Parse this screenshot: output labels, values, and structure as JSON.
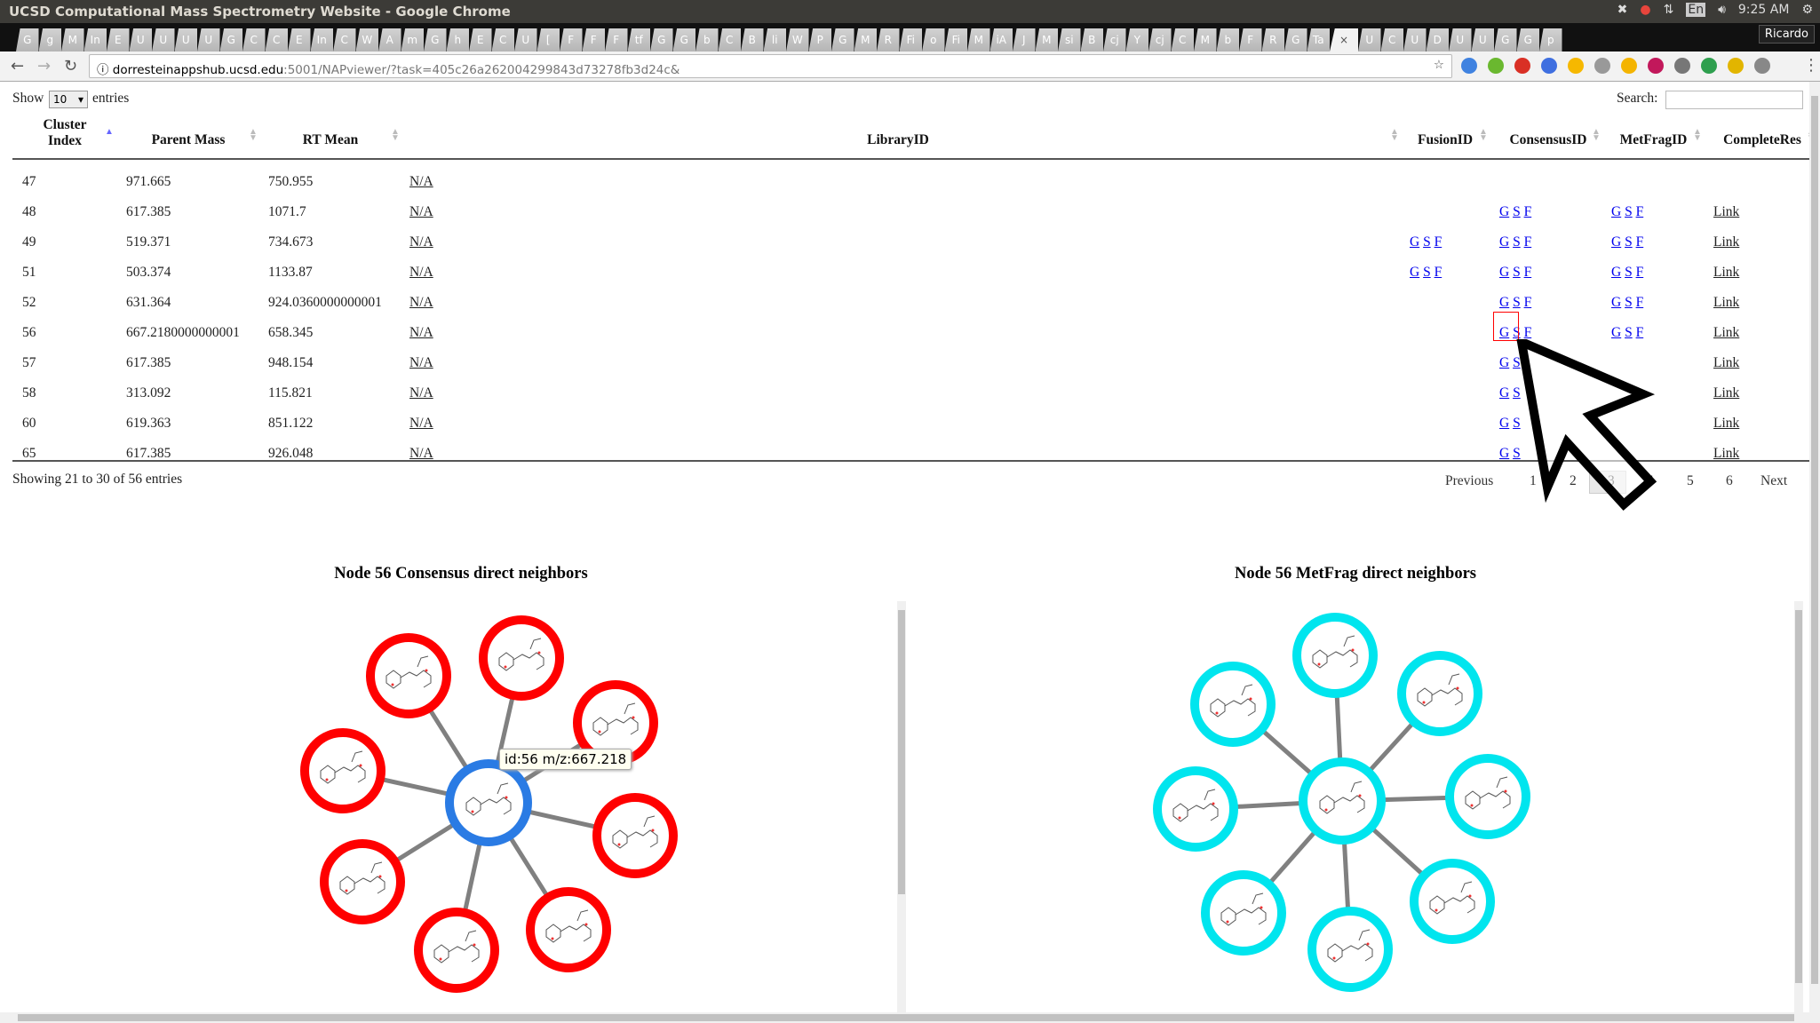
{
  "window": {
    "title": "UCSD Computational Mass Spectrometry Website - Google Chrome",
    "clock": "9:25 AM",
    "lang": "En",
    "user": "Ricardo"
  },
  "tabs": [
    "G",
    "g",
    "M",
    "In",
    "E",
    "U",
    "U",
    "U",
    "U",
    "G",
    "C",
    "C",
    "E",
    "In",
    "C",
    "W",
    "A",
    "m",
    "G",
    "h",
    "E",
    "C",
    "U",
    "[",
    "F",
    "F",
    "F",
    "tf",
    "G",
    "G",
    "b",
    "C",
    "B",
    "li",
    "W",
    "P",
    "G",
    "M",
    "R",
    "Fi",
    "o",
    "Fi",
    "M",
    "iA",
    "J",
    "M",
    "si",
    "B",
    "cj",
    "Y",
    "cj",
    "C",
    "M",
    "b",
    "F",
    "R",
    "G",
    "Ta",
    "×",
    "U",
    "C",
    "U",
    "D",
    "U",
    "U",
    "G",
    "G",
    "p"
  ],
  "active_tab_index": 58,
  "address": {
    "host": "dorresteinappshub.ucsd.edu",
    "rest": ":5001/NAPviewer/?task=405c26a262004299843d73278fb3d24c&"
  },
  "extension_icons": [
    "#3f82e0",
    "#6ab82f",
    "#d93025",
    "#3f6fe0",
    "#f6b800",
    "#999",
    "#f4b400",
    "#c2185b",
    "#777",
    "#2e9f4e",
    "#e2b500",
    "#888"
  ],
  "controls": {
    "show": "Show",
    "entries_value": "10",
    "entries": "entries",
    "search_label": "Search:",
    "search_value": ""
  },
  "columns": [
    "Cluster Index",
    "Parent Mass",
    "RT Mean",
    "LibraryID",
    "FusionID",
    "ConsensusID",
    "MetFragID",
    "CompleteRes"
  ],
  "rows": [
    {
      "cluster": "47",
      "mass": "971.665",
      "rt": "750.955",
      "lib": "N/A",
      "fusion": "",
      "consensus": "",
      "metfrag": "",
      "complete": ""
    },
    {
      "cluster": "48",
      "mass": "617.385",
      "rt": "1071.7",
      "lib": "N/A",
      "fusion": "",
      "consensus": "G S F",
      "metfrag": "G S F",
      "complete": "Link"
    },
    {
      "cluster": "49",
      "mass": "519.371",
      "rt": "734.673",
      "lib": "N/A",
      "fusion": "G S F",
      "consensus": "G S F",
      "metfrag": "G S F",
      "complete": "Link"
    },
    {
      "cluster": "51",
      "mass": "503.374",
      "rt": "1133.87",
      "lib": "N/A",
      "fusion": "G S F",
      "consensus": "G S F",
      "metfrag": "G S F",
      "complete": "Link"
    },
    {
      "cluster": "52",
      "mass": "631.364",
      "rt": "924.0360000000001",
      "lib": "N/A",
      "fusion": "",
      "consensus": "G S F",
      "metfrag": "G S F",
      "complete": "Link"
    },
    {
      "cluster": "56",
      "mass": "667.2180000000001",
      "rt": "658.345",
      "lib": "N/A",
      "fusion": "",
      "consensus": "G S F",
      "metfrag": "G S F",
      "complete": "Link"
    },
    {
      "cluster": "57",
      "mass": "617.385",
      "rt": "948.154",
      "lib": "N/A",
      "fusion": "",
      "consensus": "G S",
      "metfrag": "",
      "complete": "Link"
    },
    {
      "cluster": "58",
      "mass": "313.092",
      "rt": "115.821",
      "lib": "N/A",
      "fusion": "",
      "consensus": "G S",
      "metfrag": "",
      "complete": "Link"
    },
    {
      "cluster": "60",
      "mass": "619.363",
      "rt": "851.122",
      "lib": "N/A",
      "fusion": "",
      "consensus": "G S",
      "metfrag": "",
      "complete": "Link"
    },
    {
      "cluster": "65",
      "mass": "617.385",
      "rt": "926.048",
      "lib": "N/A",
      "fusion": "",
      "consensus": "G S",
      "metfrag": "",
      "complete": "Link"
    }
  ],
  "info": "Showing 21 to 30 of 56 entries",
  "pagination": {
    "previous": "Previous",
    "pages": [
      "1",
      "2",
      "3",
      "4",
      "5",
      "6"
    ],
    "current": "3",
    "next": "Next"
  },
  "graphs": {
    "left": {
      "title": "Node 56 Consensus direct neighbors",
      "center_color": "#2a7be4",
      "neighbor_color": "#ff0000",
      "neighbors": 8,
      "tooltip": "id:56 m/z:667.218"
    },
    "right": {
      "title": "Node 56 MetFrag direct neighbors",
      "center_color": "#00e5ee",
      "neighbor_color": "#00e5ee",
      "neighbors": 8
    }
  }
}
